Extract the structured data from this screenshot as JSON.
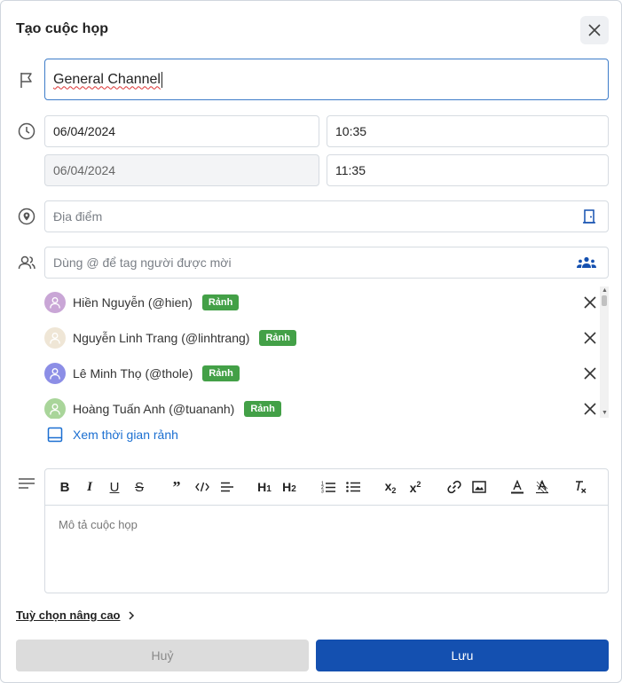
{
  "dialog": {
    "title": "Tạo cuộc họp"
  },
  "meeting": {
    "title_value": "General Channel",
    "start_date": "06/04/2024",
    "start_time": "10:35",
    "end_date": "06/04/2024",
    "end_time": "11:35",
    "location_placeholder": "Địa điểm",
    "invite_placeholder": "Dùng @ để tag người được mời"
  },
  "invitees": [
    {
      "name": "Hiền Nguyễn (@hien)",
      "status": "Rảnh",
      "avatar_color": "#c9a6d6"
    },
    {
      "name": "Nguyễn Linh Trang (@linhtrang)",
      "status": "Rảnh",
      "avatar_color": "#efe6d6"
    },
    {
      "name": "Lê Minh Thọ (@thole)",
      "status": "Rảnh",
      "avatar_color": "#8c8ee6"
    },
    {
      "name": "Hoàng Tuấn Anh (@tuananh)",
      "status": "Rảnh",
      "avatar_color": "#a9d59a"
    }
  ],
  "free_time_link": "Xem thời gian rảnh",
  "editor": {
    "placeholder": "Mô tả cuộc họp",
    "tools": [
      "bold-icon",
      "italic-icon",
      "underline-icon",
      "strikethrough-icon",
      "quote-icon",
      "code-icon",
      "align-icon",
      "heading-1-icon",
      "heading-2-icon",
      "ordered-list-icon",
      "bullet-list-icon",
      "subscript-icon",
      "superscript-icon",
      "link-icon",
      "image-icon",
      "text-color-icon",
      "highlight-icon",
      "clear-format-icon"
    ]
  },
  "advanced_options": "Tuỳ chọn nâng cao",
  "buttons": {
    "cancel": "Huỷ",
    "save": "Lưu"
  },
  "colors": {
    "primary": "#1450b0",
    "link": "#1b6fd1",
    "badge_green": "#43a047",
    "focus_border": "#3d7cc9"
  }
}
